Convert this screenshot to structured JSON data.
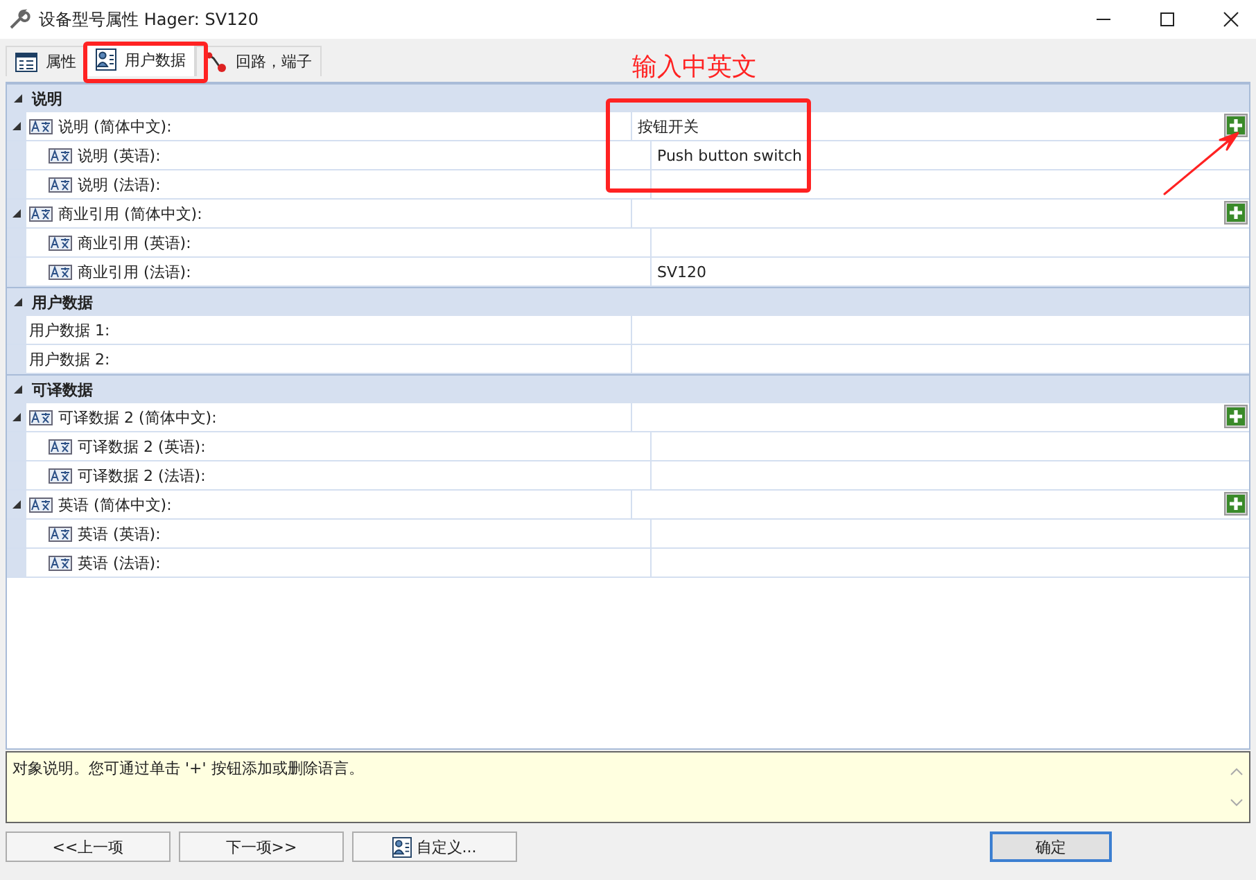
{
  "window": {
    "title": "设备型号属性 Hager: SV120"
  },
  "tabs": [
    {
      "label": "属性",
      "selected": false
    },
    {
      "label": "用户数据",
      "selected": true
    },
    {
      "label": "回路，端子",
      "selected": false
    }
  ],
  "sections": [
    {
      "title": "说明",
      "expanded": true,
      "rows": [
        {
          "kind": "translatable",
          "label": "说明 (简体中文):",
          "value": "按钮开关",
          "add_button": true,
          "expanded": true,
          "children": [
            {
              "label": "说明 (英语):",
              "value": "Push button switch"
            },
            {
              "label": "说明 (法语):"
            }
          ]
        },
        {
          "kind": "translatable",
          "label": "商业引用 (简体中文):",
          "add_button": true,
          "expanded": true,
          "children": [
            {
              "label": "商业引用 (英语):"
            },
            {
              "label": "商业引用 (法语):",
              "value": "SV120"
            }
          ]
        }
      ]
    },
    {
      "title": "用户数据",
      "expanded": true,
      "rows": [
        {
          "kind": "plain",
          "label": "用户数据 1:"
        },
        {
          "kind": "plain",
          "label": "用户数据 2:"
        }
      ]
    },
    {
      "title": "可译数据",
      "expanded": true,
      "rows": [
        {
          "kind": "translatable",
          "label": "可译数据 2 (简体中文):",
          "add_button": true,
          "expanded": true,
          "children": [
            {
              "label": "可译数据 2 (英语):"
            },
            {
              "label": "可译数据 2 (法语):"
            }
          ]
        },
        {
          "kind": "translatable",
          "label": "英语 (简体中文):",
          "add_button": true,
          "expanded": true,
          "children": [
            {
              "label": "英语 (英语):"
            },
            {
              "label": "英语 (法语):"
            }
          ]
        }
      ]
    }
  ],
  "description": "对象说明。您可通过单击 '+' 按钮添加或删除语言。",
  "buttons": [
    {
      "label": "<<上一项",
      "kind": "plain"
    },
    {
      "label": "下一项>>",
      "kind": "plain"
    },
    {
      "label": "自定义...",
      "kind": "icon"
    },
    {
      "label": "确定",
      "kind": "default"
    }
  ],
  "annotation": {
    "text": "输入中英文"
  }
}
